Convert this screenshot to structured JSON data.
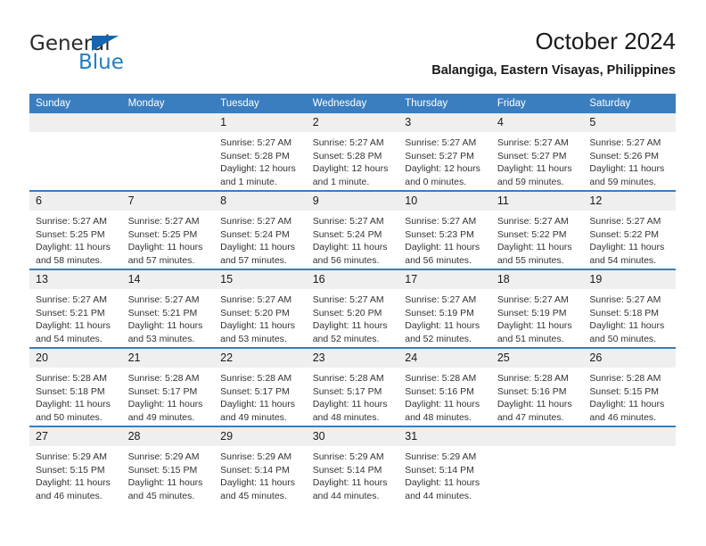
{
  "logo": {
    "text_primary": "General",
    "text_secondary": "Blue",
    "primary_color": "#2b2b2b",
    "secondary_color": "#1f7ec4",
    "triangle_color": "#1565b0"
  },
  "header": {
    "title": "October 2024",
    "subtitle": "Balangiga, Eastern Visayas, Philippines"
  },
  "theme": {
    "header_row_bg": "#3a7ebf",
    "header_row_text": "#ffffff",
    "daynum_bg": "#efefef",
    "row_divider": "#3a7ebf",
    "body_text": "#333333"
  },
  "weekday_headers": [
    "Sunday",
    "Monday",
    "Tuesday",
    "Wednesday",
    "Thursday",
    "Friday",
    "Saturday"
  ],
  "weeks": [
    [
      {
        "day": "",
        "blank": true,
        "sunrise": "",
        "sunset": "",
        "daylight": ""
      },
      {
        "day": "",
        "blank": true,
        "sunrise": "",
        "sunset": "",
        "daylight": ""
      },
      {
        "day": "1",
        "sunrise": "Sunrise: 5:27 AM",
        "sunset": "Sunset: 5:28 PM",
        "daylight": "Daylight: 12 hours and 1 minute."
      },
      {
        "day": "2",
        "sunrise": "Sunrise: 5:27 AM",
        "sunset": "Sunset: 5:28 PM",
        "daylight": "Daylight: 12 hours and 1 minute."
      },
      {
        "day": "3",
        "sunrise": "Sunrise: 5:27 AM",
        "sunset": "Sunset: 5:27 PM",
        "daylight": "Daylight: 12 hours and 0 minutes."
      },
      {
        "day": "4",
        "sunrise": "Sunrise: 5:27 AM",
        "sunset": "Sunset: 5:27 PM",
        "daylight": "Daylight: 11 hours and 59 minutes."
      },
      {
        "day": "5",
        "sunrise": "Sunrise: 5:27 AM",
        "sunset": "Sunset: 5:26 PM",
        "daylight": "Daylight: 11 hours and 59 minutes."
      }
    ],
    [
      {
        "day": "6",
        "sunrise": "Sunrise: 5:27 AM",
        "sunset": "Sunset: 5:25 PM",
        "daylight": "Daylight: 11 hours and 58 minutes."
      },
      {
        "day": "7",
        "sunrise": "Sunrise: 5:27 AM",
        "sunset": "Sunset: 5:25 PM",
        "daylight": "Daylight: 11 hours and 57 minutes."
      },
      {
        "day": "8",
        "sunrise": "Sunrise: 5:27 AM",
        "sunset": "Sunset: 5:24 PM",
        "daylight": "Daylight: 11 hours and 57 minutes."
      },
      {
        "day": "9",
        "sunrise": "Sunrise: 5:27 AM",
        "sunset": "Sunset: 5:24 PM",
        "daylight": "Daylight: 11 hours and 56 minutes."
      },
      {
        "day": "10",
        "sunrise": "Sunrise: 5:27 AM",
        "sunset": "Sunset: 5:23 PM",
        "daylight": "Daylight: 11 hours and 56 minutes."
      },
      {
        "day": "11",
        "sunrise": "Sunrise: 5:27 AM",
        "sunset": "Sunset: 5:22 PM",
        "daylight": "Daylight: 11 hours and 55 minutes."
      },
      {
        "day": "12",
        "sunrise": "Sunrise: 5:27 AM",
        "sunset": "Sunset: 5:22 PM",
        "daylight": "Daylight: 11 hours and 54 minutes."
      }
    ],
    [
      {
        "day": "13",
        "sunrise": "Sunrise: 5:27 AM",
        "sunset": "Sunset: 5:21 PM",
        "daylight": "Daylight: 11 hours and 54 minutes."
      },
      {
        "day": "14",
        "sunrise": "Sunrise: 5:27 AM",
        "sunset": "Sunset: 5:21 PM",
        "daylight": "Daylight: 11 hours and 53 minutes."
      },
      {
        "day": "15",
        "sunrise": "Sunrise: 5:27 AM",
        "sunset": "Sunset: 5:20 PM",
        "daylight": "Daylight: 11 hours and 53 minutes."
      },
      {
        "day": "16",
        "sunrise": "Sunrise: 5:27 AM",
        "sunset": "Sunset: 5:20 PM",
        "daylight": "Daylight: 11 hours and 52 minutes."
      },
      {
        "day": "17",
        "sunrise": "Sunrise: 5:27 AM",
        "sunset": "Sunset: 5:19 PM",
        "daylight": "Daylight: 11 hours and 52 minutes."
      },
      {
        "day": "18",
        "sunrise": "Sunrise: 5:27 AM",
        "sunset": "Sunset: 5:19 PM",
        "daylight": "Daylight: 11 hours and 51 minutes."
      },
      {
        "day": "19",
        "sunrise": "Sunrise: 5:27 AM",
        "sunset": "Sunset: 5:18 PM",
        "daylight": "Daylight: 11 hours and 50 minutes."
      }
    ],
    [
      {
        "day": "20",
        "sunrise": "Sunrise: 5:28 AM",
        "sunset": "Sunset: 5:18 PM",
        "daylight": "Daylight: 11 hours and 50 minutes."
      },
      {
        "day": "21",
        "sunrise": "Sunrise: 5:28 AM",
        "sunset": "Sunset: 5:17 PM",
        "daylight": "Daylight: 11 hours and 49 minutes."
      },
      {
        "day": "22",
        "sunrise": "Sunrise: 5:28 AM",
        "sunset": "Sunset: 5:17 PM",
        "daylight": "Daylight: 11 hours and 49 minutes."
      },
      {
        "day": "23",
        "sunrise": "Sunrise: 5:28 AM",
        "sunset": "Sunset: 5:17 PM",
        "daylight": "Daylight: 11 hours and 48 minutes."
      },
      {
        "day": "24",
        "sunrise": "Sunrise: 5:28 AM",
        "sunset": "Sunset: 5:16 PM",
        "daylight": "Daylight: 11 hours and 48 minutes."
      },
      {
        "day": "25",
        "sunrise": "Sunrise: 5:28 AM",
        "sunset": "Sunset: 5:16 PM",
        "daylight": "Daylight: 11 hours and 47 minutes."
      },
      {
        "day": "26",
        "sunrise": "Sunrise: 5:28 AM",
        "sunset": "Sunset: 5:15 PM",
        "daylight": "Daylight: 11 hours and 46 minutes."
      }
    ],
    [
      {
        "day": "27",
        "sunrise": "Sunrise: 5:29 AM",
        "sunset": "Sunset: 5:15 PM",
        "daylight": "Daylight: 11 hours and 46 minutes."
      },
      {
        "day": "28",
        "sunrise": "Sunrise: 5:29 AM",
        "sunset": "Sunset: 5:15 PM",
        "daylight": "Daylight: 11 hours and 45 minutes."
      },
      {
        "day": "29",
        "sunrise": "Sunrise: 5:29 AM",
        "sunset": "Sunset: 5:14 PM",
        "daylight": "Daylight: 11 hours and 45 minutes."
      },
      {
        "day": "30",
        "sunrise": "Sunrise: 5:29 AM",
        "sunset": "Sunset: 5:14 PM",
        "daylight": "Daylight: 11 hours and 44 minutes."
      },
      {
        "day": "31",
        "sunrise": "Sunrise: 5:29 AM",
        "sunset": "Sunset: 5:14 PM",
        "daylight": "Daylight: 11 hours and 44 minutes."
      },
      {
        "day": "",
        "blank": true,
        "sunrise": "",
        "sunset": "",
        "daylight": ""
      },
      {
        "day": "",
        "blank": true,
        "sunrise": "",
        "sunset": "",
        "daylight": ""
      }
    ]
  ]
}
